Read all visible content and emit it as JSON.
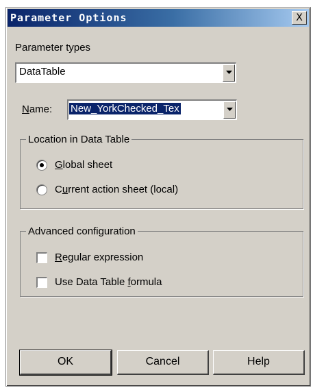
{
  "dialog": {
    "title": "Parameter Options",
    "close_glyph": "X"
  },
  "parameter_types": {
    "label": "Parameter types",
    "value": "DataTable"
  },
  "name": {
    "label_rest": "ame:",
    "label_mnemonic": "N",
    "value": "New_YorkChecked_Tex"
  },
  "location": {
    "legend": "Location in Data Table",
    "options": [
      {
        "mnemonic": "G",
        "rest": "lobal sheet",
        "selected": true
      },
      {
        "prefix": "C",
        "mnemonic": "u",
        "rest": "rrent action sheet (local)",
        "selected": false
      }
    ]
  },
  "advanced": {
    "legend": "Advanced configuration",
    "regular_expression": {
      "mnemonic": "R",
      "rest": "egular expression",
      "checked": false
    },
    "formula": {
      "prefix": "Use Data Table ",
      "mnemonic": "f",
      "rest": "ormula",
      "checked": false
    }
  },
  "buttons": {
    "ok": "OK",
    "cancel": "Cancel",
    "help": "Help"
  },
  "icons": {
    "dropdown": "chevron-down-icon",
    "close": "close-icon"
  },
  "colors": {
    "selection": "#0a246a",
    "face": "#d4d0c8",
    "title_start": "#0a246a",
    "title_end": "#a6caf0"
  }
}
